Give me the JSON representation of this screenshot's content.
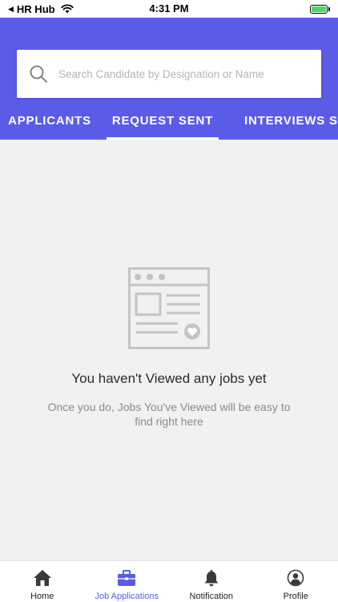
{
  "status_bar": {
    "back_app": "HR Hub",
    "time": "4:31 PM"
  },
  "search": {
    "placeholder": "Search Candidate by Designation or Name"
  },
  "tabs": [
    {
      "label": "APPLICANTS",
      "active": false
    },
    {
      "label": "REQUEST SENT",
      "active": true
    },
    {
      "label": "INTERVIEWS SCHEDULED",
      "active": false
    }
  ],
  "empty_state": {
    "title": "You haven't Viewed any jobs yet",
    "subtitle": "Once you do, Jobs You've Viewed will be easy to find right here"
  },
  "bottom_nav": [
    {
      "label": "Home",
      "icon": "home-icon",
      "active": false
    },
    {
      "label": "Job Applications",
      "icon": "briefcase-icon",
      "active": true
    },
    {
      "label": "Notification",
      "icon": "bell-icon",
      "active": false
    },
    {
      "label": "Profile",
      "icon": "profile-icon",
      "active": false
    }
  ],
  "colors": {
    "primary": "#5a5ce8",
    "background": "#f1f1f1",
    "illustration": "#c4c4c4",
    "battery": "#4cd964"
  }
}
